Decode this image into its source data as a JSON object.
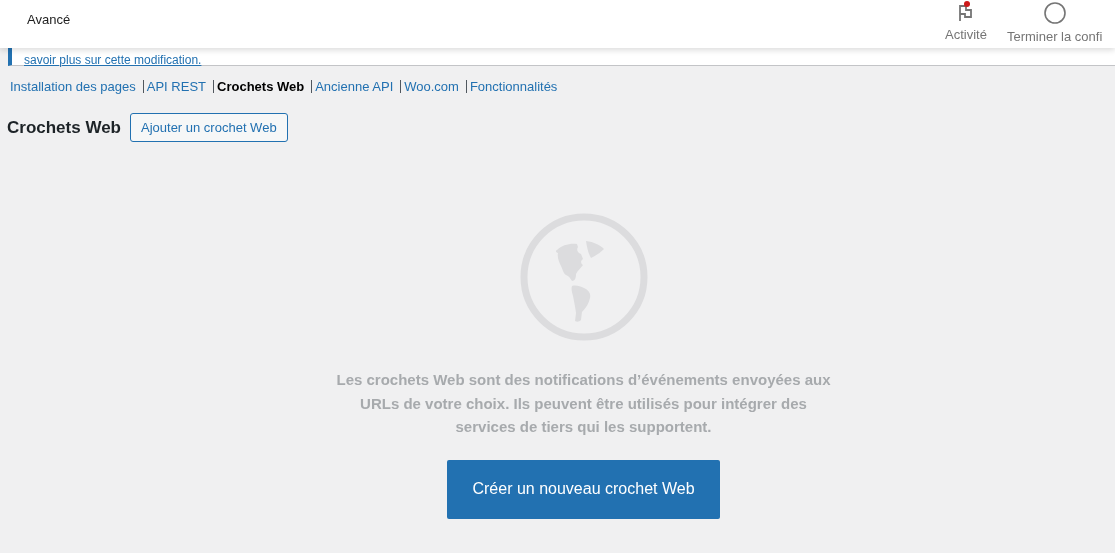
{
  "header": {
    "title": "Avancé",
    "actions": [
      {
        "kind": "activity",
        "label": "Activité",
        "badge": true
      },
      {
        "kind": "setup",
        "label": "Terminer la confi"
      }
    ]
  },
  "notice": {
    "link": "savoir plus sur cette modification."
  },
  "subnav": [
    {
      "label": "Installation des pages",
      "selected": false
    },
    {
      "label": "API REST",
      "selected": false
    },
    {
      "label": "Crochets Web",
      "selected": true
    },
    {
      "label": "Ancienne API",
      "selected": false
    },
    {
      "label": "Woo.com",
      "selected": false
    },
    {
      "label": "Fonctionnalités",
      "selected": false
    }
  ],
  "page": {
    "title": "Crochets Web",
    "add_button": "Ajouter un crochet Web"
  },
  "empty_state": {
    "message": "Les crochets Web sont des notifications d’événements envoyées aux URLs de votre choix. Ils peuvent être utilisés pour intégrer des services de tiers qui les supportent.",
    "button": "Créer un nouveau crochet Web"
  }
}
